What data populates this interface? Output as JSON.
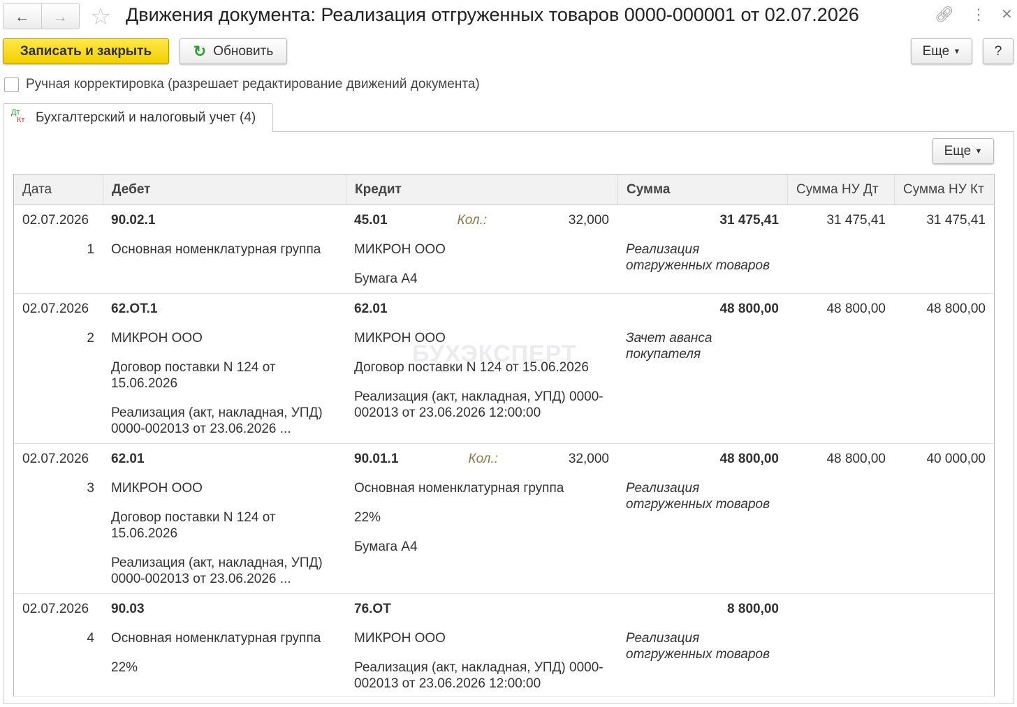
{
  "window": {
    "title": "Движения документа: Реализация отгруженных товаров 0000-000001 от 02.07.2026"
  },
  "toolbar": {
    "save_close": "Записать и закрыть",
    "refresh": "Обновить",
    "more": "Еще",
    "help": "?"
  },
  "manual_edit": {
    "label": "Ручная корректировка (разрешает редактирование движений документа)",
    "checked": false
  },
  "tab": {
    "icon_top": "Дт",
    "icon_bottom": "Кт",
    "label": "Бухгалтерский и налоговый учет (4)"
  },
  "panel": {
    "more": "Еще"
  },
  "watermark": "БУХЭКСПЕРТ",
  "columns": [
    "Дата",
    "Дебет",
    "Кредит",
    "Сумма",
    "Сумма НУ Дт",
    "Сумма НУ Кт"
  ],
  "rows": [
    {
      "date": "02.07.2026",
      "num": "1",
      "debit": [
        "90.02.1",
        "Основная номенклатурная группа"
      ],
      "credit": [
        "45.01",
        "МИКРОН ООО",
        "Бумага А4"
      ],
      "qty_label": "Кол.:",
      "qty": "32,000",
      "sum": "31 475,41",
      "comment": "Реализация отгруженных товаров",
      "nu_dt": "31 475,41",
      "nu_kt": "31 475,41"
    },
    {
      "date": "02.07.2026",
      "num": "2",
      "debit": [
        "62.ОТ.1",
        "МИКРОН ООО",
        "Договор поставки N 124 от 15.06.2026",
        "Реализация (акт, накладная, УПД) 0000-002013 от 23.06.2026 ..."
      ],
      "credit": [
        "62.01",
        "МИКРОН ООО",
        "Договор поставки N 124 от 15.06.2026",
        "Реализация (акт, накладная, УПД) 0000-002013 от 23.06.2026 12:00:00"
      ],
      "sum": "48 800,00",
      "comment": "Зачет аванса покупателя",
      "nu_dt": "48 800,00",
      "nu_kt": "48 800,00"
    },
    {
      "date": "02.07.2026",
      "num": "3",
      "debit": [
        "62.01",
        "МИКРОН ООО",
        "Договор поставки N 124 от 15.06.2026",
        "Реализация (акт, накладная, УПД) 0000-002013 от 23.06.2026 ..."
      ],
      "credit": [
        "90.01.1",
        "Основная номенклатурная группа",
        "22%",
        "Бумага А4"
      ],
      "qty_label": "Кол.:",
      "qty": "32,000",
      "sum": "48 800,00",
      "comment": "Реализация отгруженных товаров",
      "nu_dt": "48 800,00",
      "nu_kt": "40 000,00"
    },
    {
      "date": "02.07.2026",
      "num": "4",
      "debit": [
        "90.03",
        "Основная номенклатурная группа",
        "22%"
      ],
      "credit": [
        "76.ОТ",
        "МИКРОН ООО",
        "Реализация (акт, накладная, УПД) 0000-002013 от 23.06.2026 12:00:00"
      ],
      "sum": "8 800,00",
      "comment": "Реализация отгруженных товаров",
      "nu_dt": "",
      "nu_kt": ""
    }
  ]
}
